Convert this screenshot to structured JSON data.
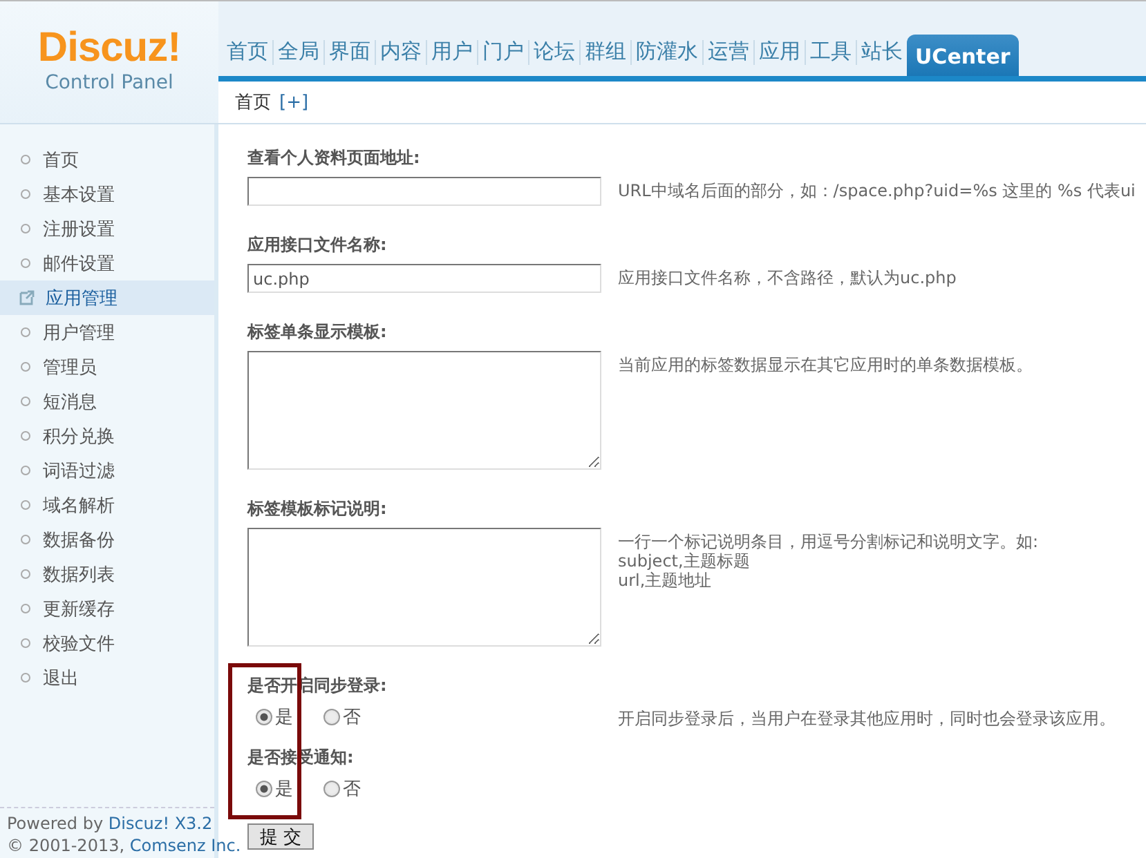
{
  "logo": {
    "brand": "Discuz!",
    "subtitle": "Control Panel"
  },
  "nav": [
    {
      "label": "首页",
      "selected": false
    },
    {
      "label": "全局",
      "selected": false
    },
    {
      "label": "界面",
      "selected": false
    },
    {
      "label": "内容",
      "selected": false
    },
    {
      "label": "用户",
      "selected": false
    },
    {
      "label": "门户",
      "selected": false
    },
    {
      "label": "论坛",
      "selected": false
    },
    {
      "label": "群组",
      "selected": false
    },
    {
      "label": "防灌水",
      "selected": false
    },
    {
      "label": "运营",
      "selected": false
    },
    {
      "label": "应用",
      "selected": false
    },
    {
      "label": "工具",
      "selected": false
    },
    {
      "label": "站长",
      "selected": false
    },
    {
      "label": "UCenter",
      "selected": true
    }
  ],
  "breadcrumb": {
    "label": "首页",
    "add": "[+]"
  },
  "sidebar": {
    "items": [
      {
        "label": "首页",
        "selected": false
      },
      {
        "label": "基本设置",
        "selected": false
      },
      {
        "label": "注册设置",
        "selected": false
      },
      {
        "label": "邮件设置",
        "selected": false
      },
      {
        "label": "应用管理",
        "selected": true
      },
      {
        "label": "用户管理",
        "selected": false
      },
      {
        "label": "管理员",
        "selected": false
      },
      {
        "label": "短消息",
        "selected": false
      },
      {
        "label": "积分兑换",
        "selected": false
      },
      {
        "label": "词语过滤",
        "selected": false
      },
      {
        "label": "域名解析",
        "selected": false
      },
      {
        "label": "数据备份",
        "selected": false
      },
      {
        "label": "数据列表",
        "selected": false
      },
      {
        "label": "更新缓存",
        "selected": false
      },
      {
        "label": "校验文件",
        "selected": false
      },
      {
        "label": "退出",
        "selected": false
      }
    ],
    "footer": [
      {
        "text": "Powered by ",
        "link": "Discuz! X3.2"
      },
      {
        "text": "© 2001-2013, ",
        "link": "Comsenz Inc."
      }
    ]
  },
  "form": {
    "fields": [
      {
        "kind": "text",
        "label": "查看个人资料页面地址:",
        "hint": [
          "URL中域名后面的部分，如：/space.php?uid=%s 这里的 %s 代表ui"
        ]
      },
      {
        "kind": "text",
        "label": "应用接口文件名称:",
        "value": "uc.php",
        "hint": [
          "应用接口文件名称，不含路径，默认为uc.php"
        ]
      },
      {
        "kind": "textarea",
        "label": "标签单条显示模板:",
        "hint": [
          "当前应用的标签数据显示在其它应用时的单条数据模板。"
        ]
      },
      {
        "kind": "textarea",
        "label": "标签模板标记说明:",
        "hint": [
          "一行一个标记说明条目，用逗号分割标记和说明文字。如:",
          "subject,主题标题",
          "url,主题地址"
        ]
      }
    ],
    "options_group": {
      "highlighted": true,
      "fields": [
        {
          "label": "是否开启同步登录:",
          "options": [
            {
              "label": "是",
              "selected": true
            },
            {
              "label": "否",
              "selected": false
            }
          ],
          "hint": "开启同步登录后，当用户在登录其他应用时，同时也会登录该应用。"
        },
        {
          "label": "是否接受通知:",
          "options": [
            {
              "label": "是",
              "selected": true
            },
            {
              "label": "否",
              "selected": false
            }
          ]
        }
      ]
    },
    "submit": "提 交"
  }
}
